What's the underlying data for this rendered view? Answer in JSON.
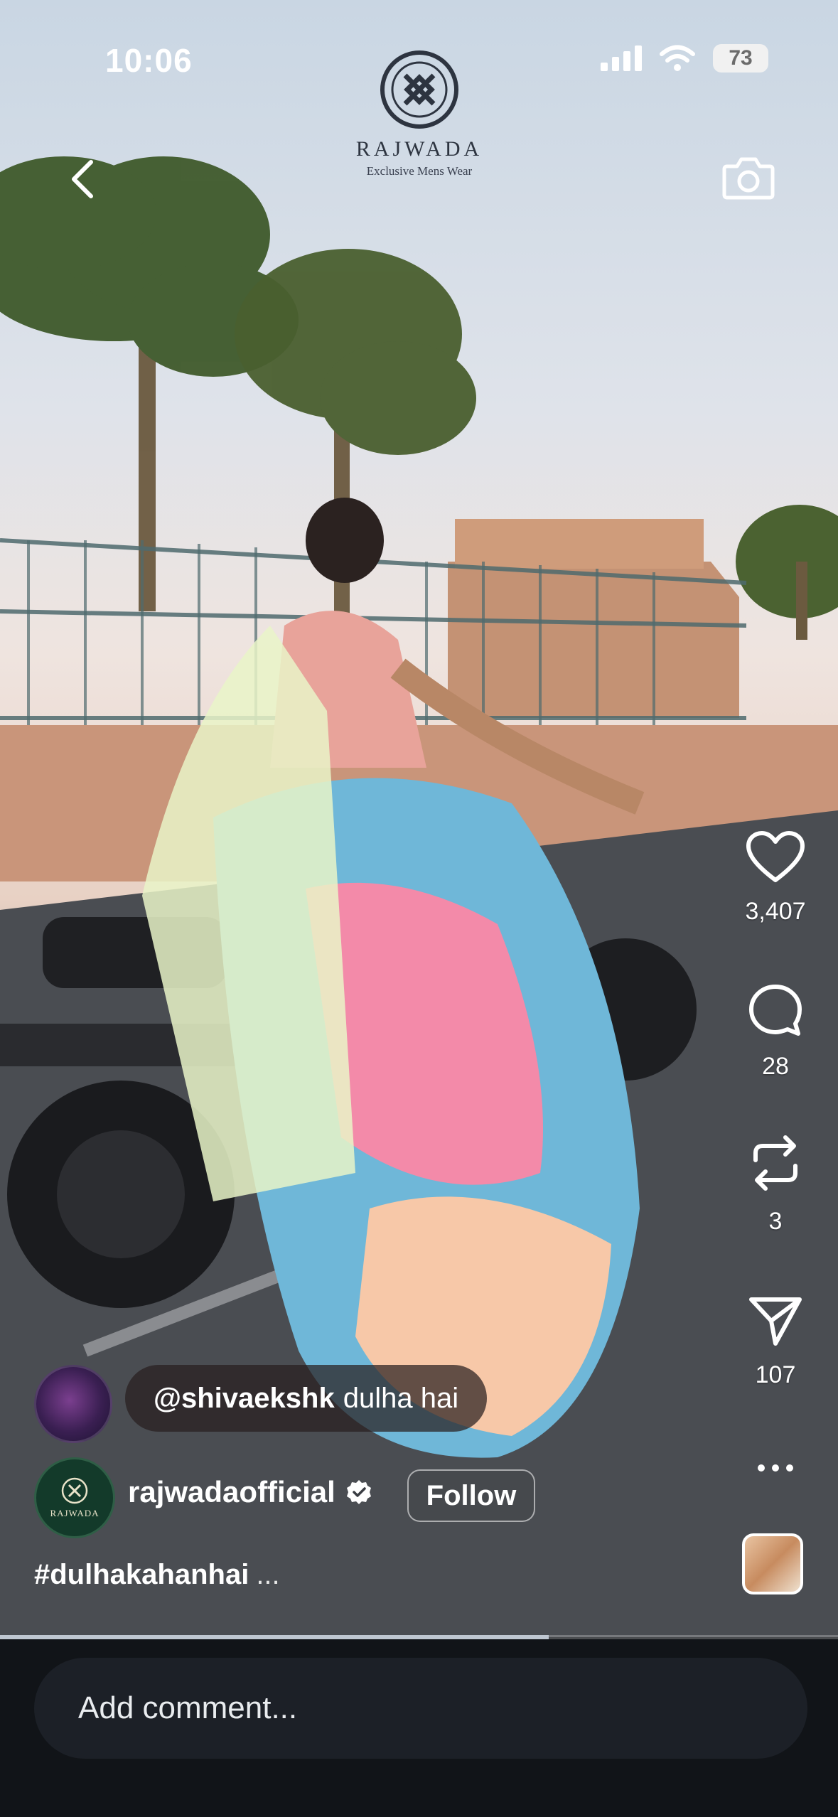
{
  "status": {
    "time": "10:06",
    "battery": "73"
  },
  "brand": {
    "name": "RAJWADA",
    "tagline": "Exclusive Mens Wear"
  },
  "rail": {
    "likes": "3,407",
    "comments": "28",
    "reposts": "3",
    "shares": "107"
  },
  "pinned_comment": {
    "user": "@shivaekshk",
    "text": "dulha hai"
  },
  "owner": {
    "username": "rajwadaofficial",
    "follow_label": "Follow",
    "avatar_text": "RAJWADA"
  },
  "caption": {
    "text": "#dulhakahanhai",
    "more": "..."
  },
  "progress": {
    "fraction": 0.655
  },
  "comment_input": {
    "placeholder": "Add comment..."
  },
  "colors": {
    "background": "#111418",
    "accent": "#ffffff"
  }
}
